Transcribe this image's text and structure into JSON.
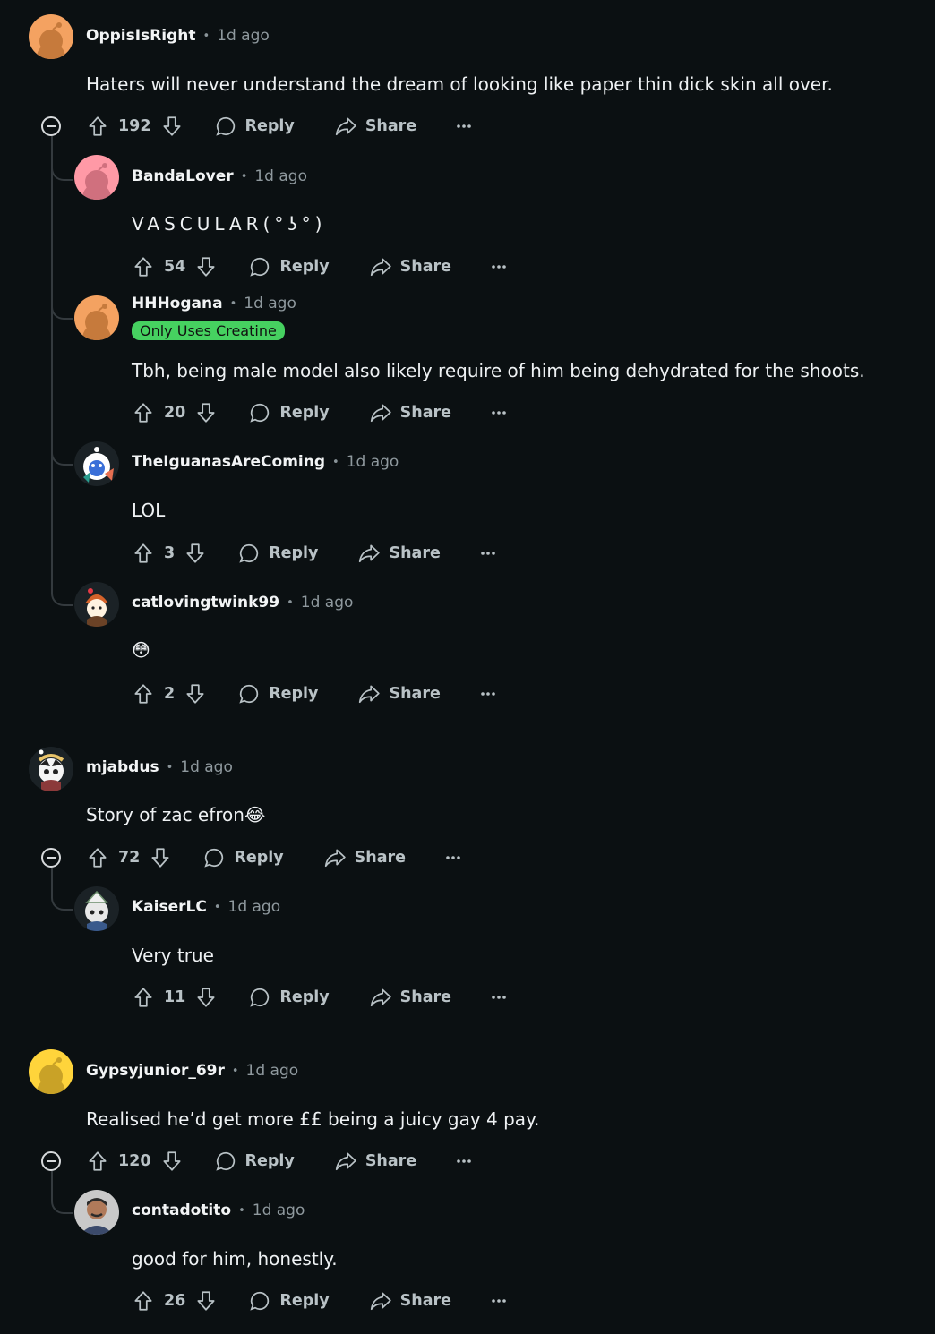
{
  "comments": [
    {
      "author": "OppisIsRight",
      "separator": "•",
      "time": "1d ago",
      "body": "Haters will never understand the dream of looking like paper thin dick skin all over.",
      "score": "192",
      "reply_label": "Reply",
      "share_label": "Share",
      "avatar_color": "#f4a261",
      "replies": [
        {
          "author": "BandaLover",
          "separator": "•",
          "time": "1d ago",
          "body": "VASCULAR(°ʖ°)",
          "score": "54",
          "reply_label": "Reply",
          "share_label": "Share",
          "avatar_color": "#ff99a6"
        },
        {
          "author": "HHHogana",
          "separator": "•",
          "time": "1d ago",
          "flair": "Only Uses Creatine",
          "body": "Tbh, being male model also likely require of him being dehydrated for the shoots.",
          "score": "20",
          "reply_label": "Reply",
          "share_label": "Share",
          "avatar_color": "#f4a261"
        },
        {
          "author": "TheIguanasAreComing",
          "separator": "•",
          "time": "1d ago",
          "body": "LOL",
          "score": "3",
          "reply_label": "Reply",
          "share_label": "Share"
        },
        {
          "author": "catlovingtwink99",
          "separator": "•",
          "time": "1d ago",
          "body": "😳",
          "score": "2",
          "reply_label": "Reply",
          "share_label": "Share"
        }
      ]
    },
    {
      "author": "mjabdus",
      "separator": "•",
      "time": "1d ago",
      "body": "Story of zac efron😂",
      "score": "72",
      "reply_label": "Reply",
      "share_label": "Share",
      "replies": [
        {
          "author": "KaiserLC",
          "separator": "•",
          "time": "1d ago",
          "body": "Very true",
          "score": "11",
          "reply_label": "Reply",
          "share_label": "Share"
        }
      ]
    },
    {
      "author": "Gypsyjunior_69r",
      "separator": "•",
      "time": "1d ago",
      "body": "Realised he’d get more ££ being a juicy gay 4 pay.",
      "score": "120",
      "reply_label": "Reply",
      "share_label": "Share",
      "avatar_color": "#ffd43b",
      "replies": [
        {
          "author": "contadotito",
          "separator": "•",
          "time": "1d ago",
          "body": "good for him, honestly.",
          "score": "26",
          "reply_label": "Reply",
          "share_label": "Share"
        }
      ]
    }
  ],
  "icons": {
    "upvote": "arrow-up-outline",
    "downvote": "arrow-down-outline",
    "reply": "speech-bubble",
    "share": "share-arrow",
    "more": "horizontal-dots",
    "collapse": "circle-minus"
  },
  "colors": {
    "background": "#0b1012",
    "flair_bg": "#46d160",
    "thread_line": "#343a3e"
  }
}
